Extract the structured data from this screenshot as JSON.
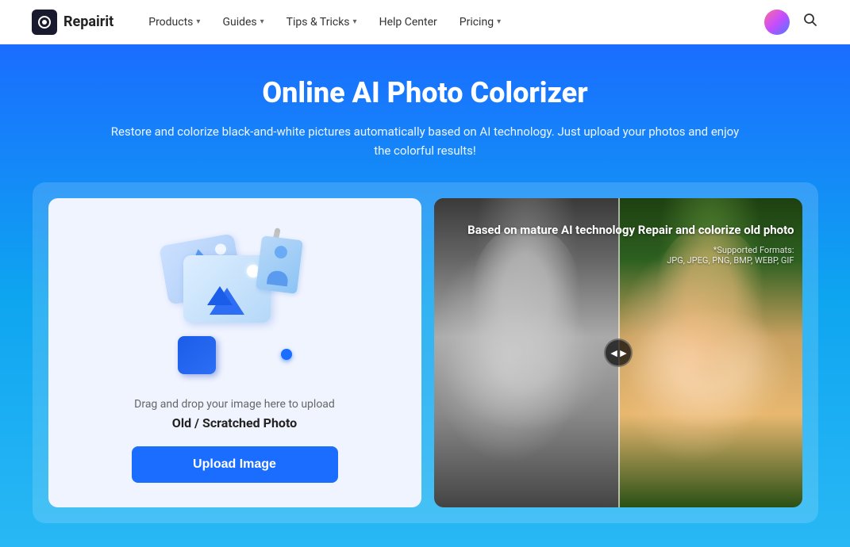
{
  "nav": {
    "logo_text": "Repairit",
    "items": [
      {
        "label": "Products",
        "has_dropdown": true
      },
      {
        "label": "Guides",
        "has_dropdown": true
      },
      {
        "label": "Tips & Tricks",
        "has_dropdown": true
      },
      {
        "label": "Help Center",
        "has_dropdown": false
      },
      {
        "label": "Pricing",
        "has_dropdown": true
      }
    ],
    "search_label": "search"
  },
  "hero": {
    "title": "Online AI Photo Colorizer",
    "subtitle": "Restore and colorize black-and-white pictures automatically based on AI technology. Just upload your photos and enjoy the colorful results!"
  },
  "upload_panel": {
    "drag_text": "Drag and drop your image here to upload",
    "drop_label": "Old / Scratched Photo",
    "btn_label": "Upload Image"
  },
  "preview": {
    "overlay_title": "Based on mature AI technology\nRepair and colorize old photo",
    "formats_label": "*Supported Formats:",
    "formats_list": "JPG, JPEG, PNG, BMP, WEBP, GIF"
  }
}
